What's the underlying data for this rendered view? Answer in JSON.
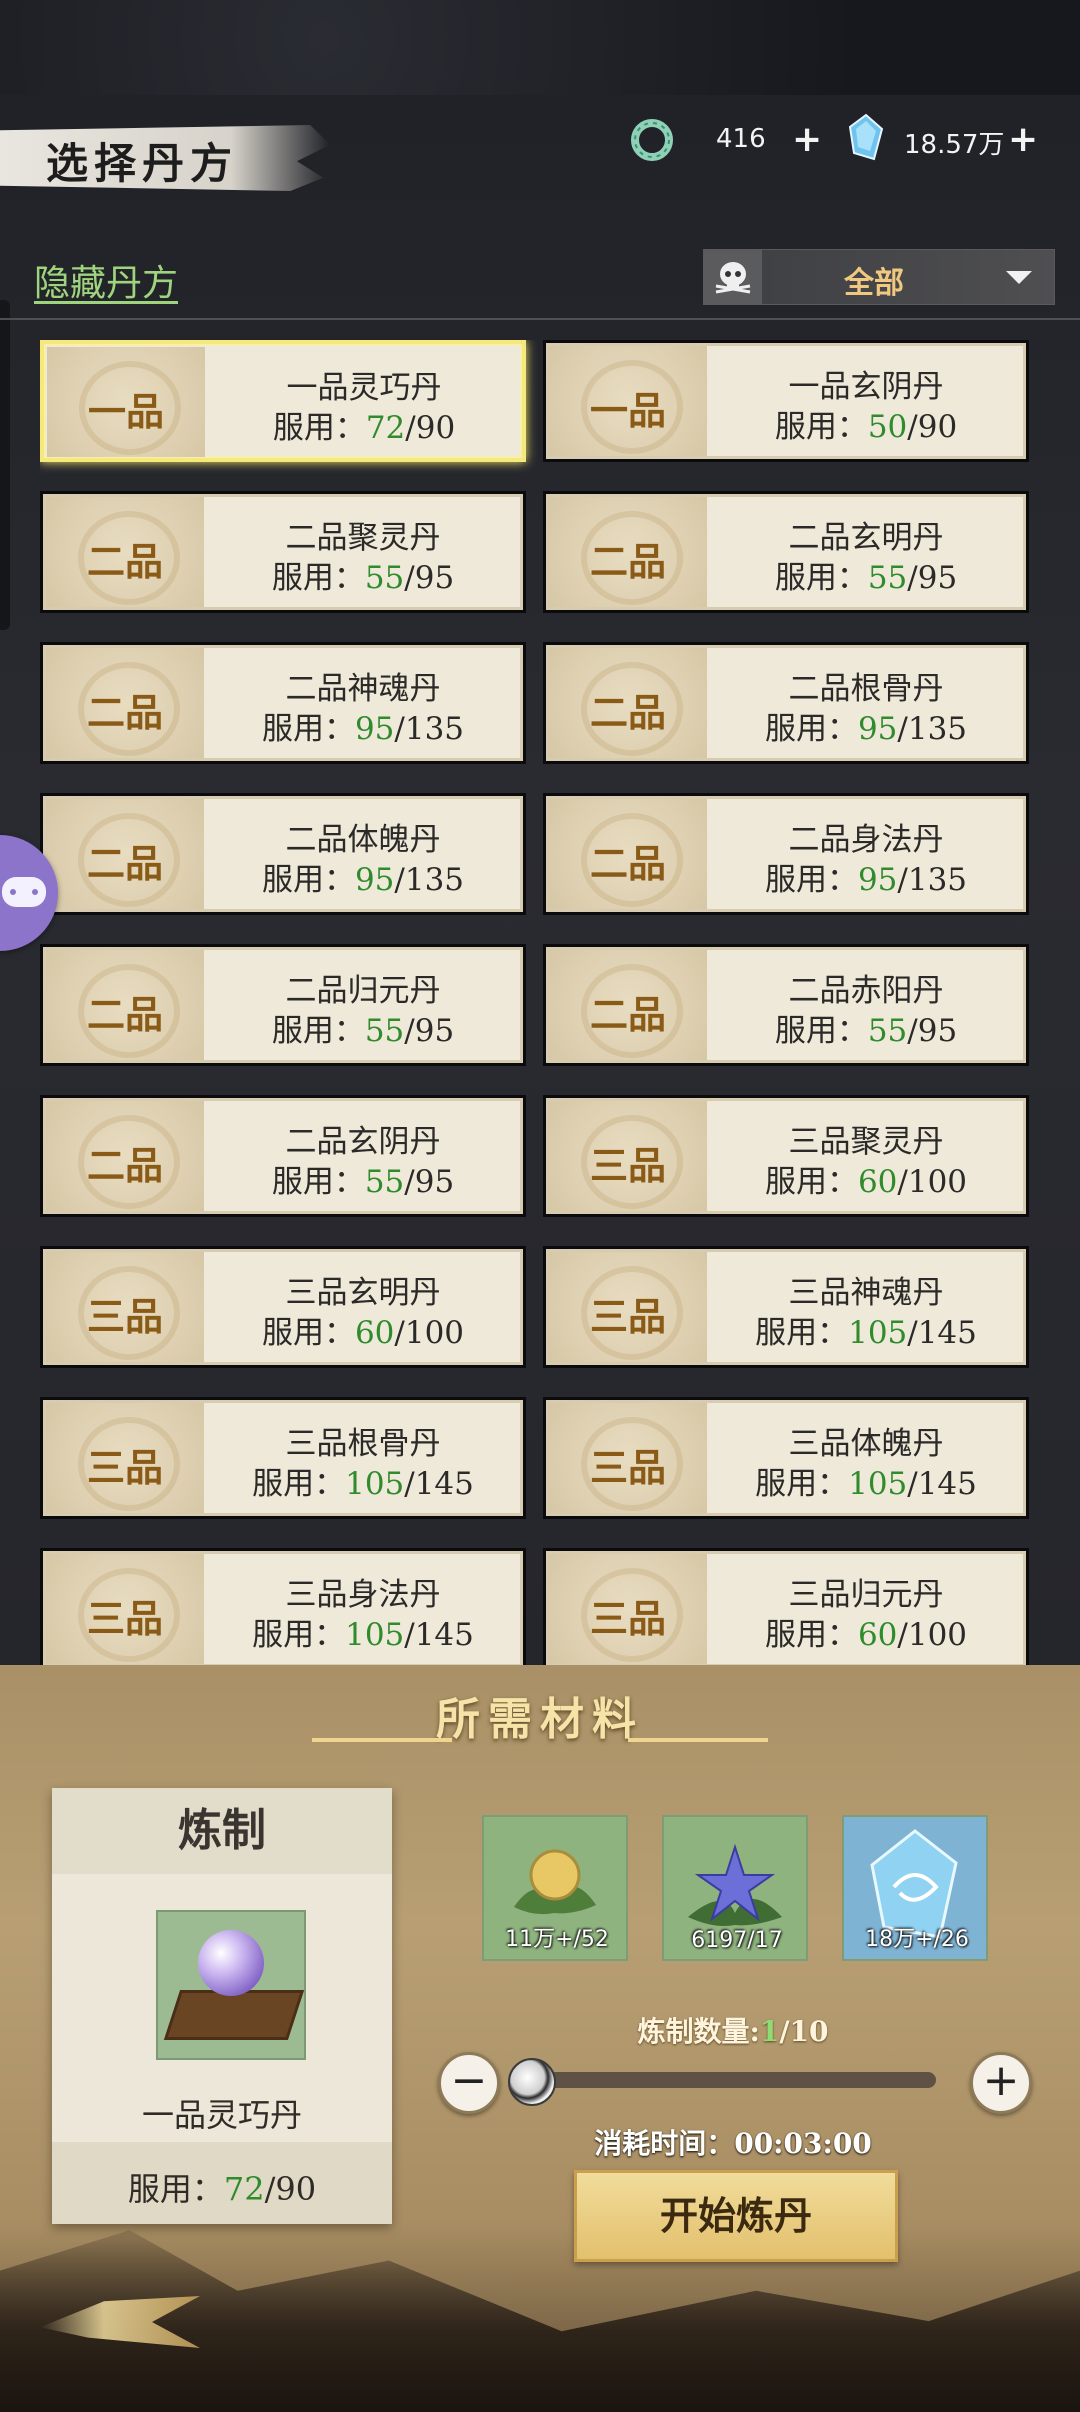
{
  "header": {
    "title": "选择丹方",
    "currency1": {
      "icon": "jade-ring-icon",
      "value": "416",
      "add": "+"
    },
    "currency2": {
      "icon": "spirit-crystal-icon",
      "value": "18.57万",
      "add": "+"
    }
  },
  "toolbar": {
    "hide_label": "隐藏丹方",
    "filter_icon": "skull-icon",
    "filter_value": "全部"
  },
  "recipes": [
    {
      "grade": "一品",
      "name": "一品灵巧丹",
      "usage_label": "服用：",
      "used": "72",
      "max": "/90",
      "selected": true
    },
    {
      "grade": "一品",
      "name": "一品玄阴丹",
      "usage_label": "服用：",
      "used": "50",
      "max": "/90"
    },
    {
      "grade": "二品",
      "name": "二品聚灵丹",
      "usage_label": "服用：",
      "used": "55",
      "max": "/95"
    },
    {
      "grade": "二品",
      "name": "二品玄明丹",
      "usage_label": "服用：",
      "used": "55",
      "max": "/95"
    },
    {
      "grade": "二品",
      "name": "二品神魂丹",
      "usage_label": "服用：",
      "used": "95",
      "max": "/135"
    },
    {
      "grade": "二品",
      "name": "二品根骨丹",
      "usage_label": "服用：",
      "used": "95",
      "max": "/135"
    },
    {
      "grade": "二品",
      "name": "二品体魄丹",
      "usage_label": "服用：",
      "used": "95",
      "max": "/135"
    },
    {
      "grade": "二品",
      "name": "二品身法丹",
      "usage_label": "服用：",
      "used": "95",
      "max": "/135"
    },
    {
      "grade": "二品",
      "name": "二品归元丹",
      "usage_label": "服用：",
      "used": "55",
      "max": "/95"
    },
    {
      "grade": "二品",
      "name": "二品赤阳丹",
      "usage_label": "服用：",
      "used": "55",
      "max": "/95"
    },
    {
      "grade": "二品",
      "name": "二品玄阴丹",
      "usage_label": "服用：",
      "used": "55",
      "max": "/95"
    },
    {
      "grade": "三品",
      "name": "三品聚灵丹",
      "usage_label": "服用：",
      "used": "60",
      "max": "/100"
    },
    {
      "grade": "三品",
      "name": "三品玄明丹",
      "usage_label": "服用：",
      "used": "60",
      "max": "/100"
    },
    {
      "grade": "三品",
      "name": "三品神魂丹",
      "usage_label": "服用：",
      "used": "105",
      "max": "/145"
    },
    {
      "grade": "三品",
      "name": "三品根骨丹",
      "usage_label": "服用：",
      "used": "105",
      "max": "/145"
    },
    {
      "grade": "三品",
      "name": "三品体魄丹",
      "usage_label": "服用：",
      "used": "105",
      "max": "/145"
    },
    {
      "grade": "三品",
      "name": "三品身法丹",
      "usage_label": "服用：",
      "used": "105",
      "max": "/145"
    },
    {
      "grade": "三品",
      "name": "三品归元丹",
      "usage_label": "服用：",
      "used": "60",
      "max": "/100"
    }
  ],
  "materials_section": {
    "title": "所需材料",
    "refine": {
      "header": "炼制",
      "item_icon": "pill-recipe-icon",
      "item_name": "一品灵巧丹",
      "usage_label": "服用：",
      "used": "72",
      "max": "/90"
    },
    "materials": [
      {
        "icon": "golden-fruit-herb-icon",
        "count": "11万+/52",
        "bg": "#8fb37f"
      },
      {
        "icon": "blue-flower-herb-icon",
        "count": "6197/17",
        "bg": "#8fb37f"
      },
      {
        "icon": "spirit-crystal-icon",
        "count": "18万+/26",
        "bg": "#7fb3d3"
      }
    ],
    "quantity_label": "炼制数量:",
    "quantity_current": "1",
    "quantity_max": "/10",
    "minus": "−",
    "plus": "+",
    "time_label": "消耗时间：",
    "time_value": "00:03:00",
    "start_button": "开始炼丹"
  },
  "colors": {
    "accent_green": "#2f8b2c",
    "link_green": "#9fd47e",
    "gold": "#f0c880"
  }
}
